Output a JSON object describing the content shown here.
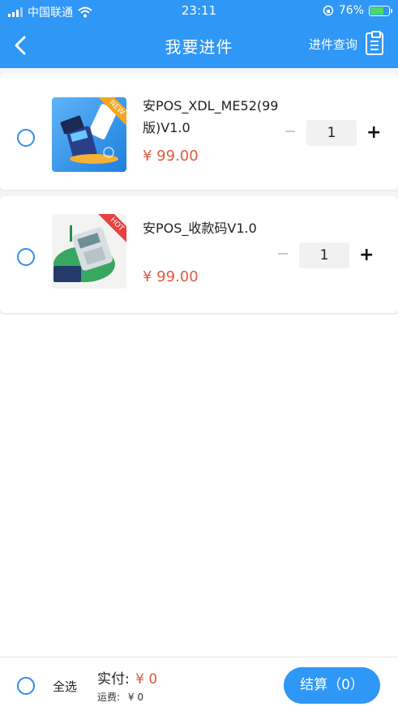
{
  "status_bar": {
    "carrier": "中国联通",
    "time": "23:11",
    "battery_percent": "76%",
    "battery_level": 0.76
  },
  "nav": {
    "title": "我要进件",
    "query_label": "进件查询"
  },
  "products": [
    {
      "name": "安POS_XDL_ME52(99版)V1.0",
      "price": "¥ 99.00",
      "quantity": "1",
      "badge": "NEW",
      "selected": false
    },
    {
      "name": "安POS_收款码V1.0",
      "price": "¥ 99.00",
      "quantity": "1",
      "badge": "HOT",
      "selected": false
    }
  ],
  "footer": {
    "select_all_label": "全选",
    "paid_label": "实付:",
    "paid_amount": "¥ 0",
    "shipping_label": "运费:",
    "shipping_amount": "¥ 0",
    "checkout_label": "结算（0）"
  },
  "colors": {
    "primary": "#2f97f5",
    "price": "#e2583e",
    "background": "#f3f4f6"
  }
}
